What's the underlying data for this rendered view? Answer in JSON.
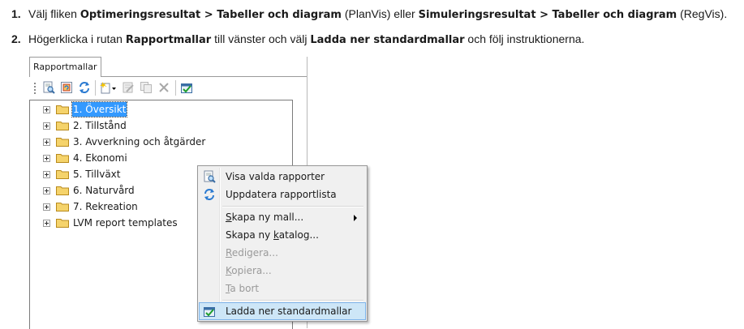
{
  "instructions": {
    "step1": {
      "number": "1.",
      "text_a": "Välj fliken ",
      "tab_opt": "Optimeringsresultat > Tabeller och diagram",
      "text_b": " (PlanVis) eller ",
      "tab_sim": "Simuleringsresultat > Tabeller och diagram",
      "text_c": " (RegVis)."
    },
    "step2": {
      "number": "2.",
      "text_a": "Högerklicka i rutan ",
      "pane": "Rapportmallar",
      "text_b": " till vänster och välj ",
      "action": "Ladda ner standardmallar",
      "text_c": " och följ instruktionerna."
    }
  },
  "panel": {
    "tab_label": "Rapportmallar",
    "toolbar_icons": [
      "view-report-icon",
      "refresh-selected-icon",
      "refresh-icon",
      "new-template-dropdown-icon",
      "edit-icon",
      "copy-icon",
      "delete-icon",
      "download-templates-icon"
    ]
  },
  "tree": {
    "items": [
      {
        "label": "1. Översikt",
        "selected": true
      },
      {
        "label": "2. Tillstånd"
      },
      {
        "label": "3. Avverkning och åtgärder"
      },
      {
        "label": "4. Ekonomi"
      },
      {
        "label": "5. Tillväxt"
      },
      {
        "label": "6. Naturvård"
      },
      {
        "label": "7. Rekreation"
      },
      {
        "label": "LVM report templates"
      }
    ]
  },
  "context_menu": {
    "items": [
      {
        "label": "Visa valda rapporter",
        "icon": "view-report-icon"
      },
      {
        "label": "Uppdatera rapportlista",
        "icon": "refresh-icon"
      },
      {
        "label": "Skapa ny mall...",
        "accel": "S",
        "rest": "kapa ny mall...",
        "submenu": true
      },
      {
        "label": "Skapa ny katalog...",
        "pre": "Skapa ny ",
        "accel": "k",
        "rest": "atalog..."
      },
      {
        "label": "Redigera...",
        "accel": "R",
        "rest": "edigera...",
        "disabled": true
      },
      {
        "label": "Kopiera...",
        "accel": "K",
        "rest": "opiera...",
        "disabled": true
      },
      {
        "label": "Ta bort",
        "accel": "T",
        "rest": "a bort",
        "disabled": true
      },
      {
        "label": "Ladda ner standardmallar",
        "icon": "download-templates-icon",
        "highlighted": true
      }
    ]
  },
  "colors": {
    "selection": "#3399ff",
    "menu_highlight": "#cde6f7",
    "folder": "#f5d36b"
  }
}
